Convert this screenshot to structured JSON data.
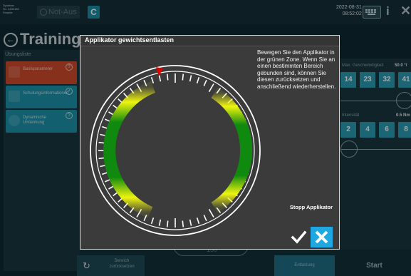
{
  "header": {
    "brand": "Dynatrac\nSn. 4400186\nSmarke",
    "notaus_label": "Not-Aus",
    "logo": "C",
    "date": "2022-08-31",
    "time": "08:52:02"
  },
  "page": {
    "title": "Training"
  },
  "left_panel": {
    "header": "Übungsliste",
    "items": [
      {
        "label": "Basisparameter",
        "badge": "?",
        "color": "#cf4a2c"
      },
      {
        "label": "Schulungsinformationen",
        "badge": "✓",
        "color": "#1c93ab"
      },
      {
        "label": "Dynamische Umlenkung",
        "badge": "?",
        "color": "#1c93ab"
      }
    ]
  },
  "right_panel": {
    "speed_label": "Max. Geschwindigkeit",
    "speed_value": "50.0",
    "speed_unit": "°/",
    "speed_options": [
      "14",
      "23",
      "32",
      "41"
    ],
    "intensity_label": "Intensität",
    "intensity_value": "0.5",
    "intensity_unit": "Nm",
    "intensity_options": [
      "2",
      "4",
      "6",
      "8"
    ]
  },
  "bottom": {
    "reset_label": "Bereich zurücksetzen",
    "entlastung_label": "Entlastung",
    "start_label": "Start",
    "behind_value": "150"
  },
  "dialog": {
    "title": "Applikator gewichtsentlasten",
    "instructions": "Bewegen Sie den Applikator in der grünen Zone. Wenn Sie an einen bestimmten Bereich gebunden sind, können Sie diesen zurücksetzen und anschließend wiederherstellen.",
    "stopp_label": "Stopp Applikator",
    "confirm_icon": "checkmark-icon",
    "cancel_icon": "close-icon",
    "colors": {
      "zone_green": "#0f8a0f",
      "zone_yellow": "#e8f00a",
      "marker": "#e00000",
      "accent": "#1ea7e0"
    }
  }
}
